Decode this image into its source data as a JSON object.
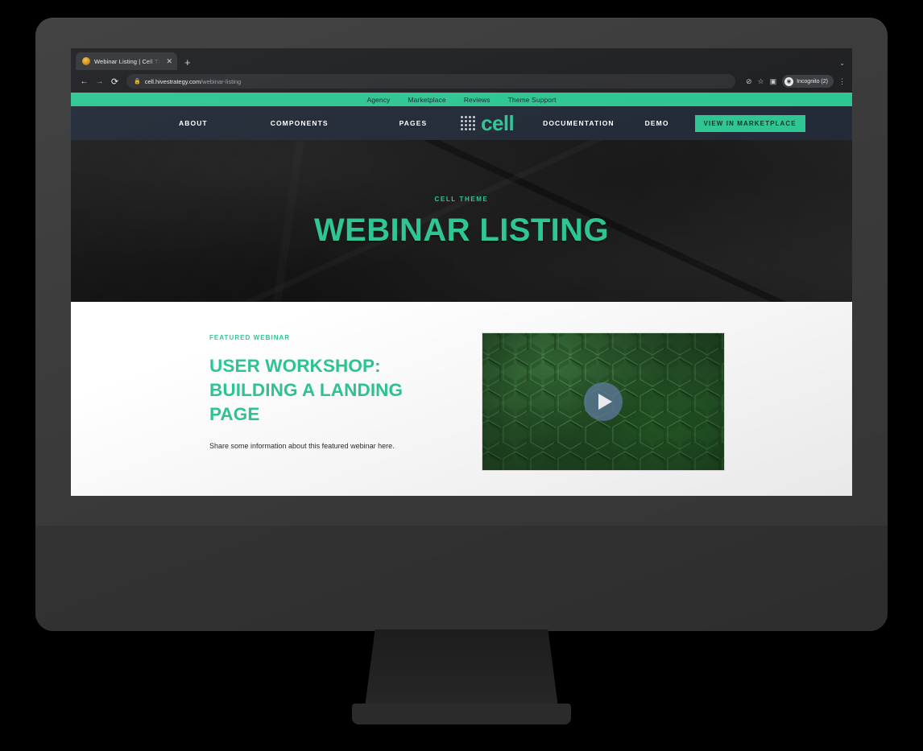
{
  "browser": {
    "tab": {
      "title": "Webinar Listing | Cell Theme | ",
      "favicon_icon": "site-favicon",
      "close_icon": "✕",
      "new_tab_icon": "+"
    },
    "collapse_icon": "⌄",
    "toolbar": {
      "back_icon": "←",
      "forward_icon": "→",
      "reload_icon": "⟳",
      "lock_icon": "🔒",
      "url_domain": "cell.hivestrategy.com",
      "url_path": "/webinar-listing",
      "hide_icon": "⊘",
      "bookmark_icon": "☆",
      "sidepanel_icon": "▣",
      "incognito_label": "Incognito (2)",
      "incognito_avatar_icon": "◉",
      "menu_icon": "⋮"
    }
  },
  "site": {
    "utility_bar": {
      "links": [
        {
          "label": "Agency"
        },
        {
          "label": "Marketplace"
        },
        {
          "label": "Reviews"
        },
        {
          "label": "Theme Support"
        }
      ]
    },
    "nav": {
      "left_links": [
        {
          "label": "ABOUT"
        },
        {
          "label": "COMPONENTS"
        },
        {
          "label": "PAGES"
        }
      ],
      "logo": {
        "wordmark": "cell",
        "mark_icon": "hex-dot-cluster-icon"
      },
      "right_links": [
        {
          "label": "DOCUMENTATION"
        },
        {
          "label": "DEMO"
        }
      ],
      "cta_label": "VIEW IN MARKETPLACE"
    },
    "hero": {
      "eyebrow": "CELL THEME",
      "title": "WEBINAR LISTING"
    },
    "featured": {
      "eyebrow": "FEATURED WEBINAR",
      "title": "USER WORKSHOP: BUILDING A LANDING PAGE",
      "description": "Share some information about this featured webinar here.",
      "video": {
        "play_icon": "play-icon",
        "thumbnail_description": "green 3d hexagon pattern"
      }
    }
  },
  "colors": {
    "brand_green": "#2ec693",
    "nav_dark": "#232b38",
    "hero_dark": "#171717",
    "bezel_grey": "#3b3b3b",
    "chrome_dark": "#202124"
  }
}
